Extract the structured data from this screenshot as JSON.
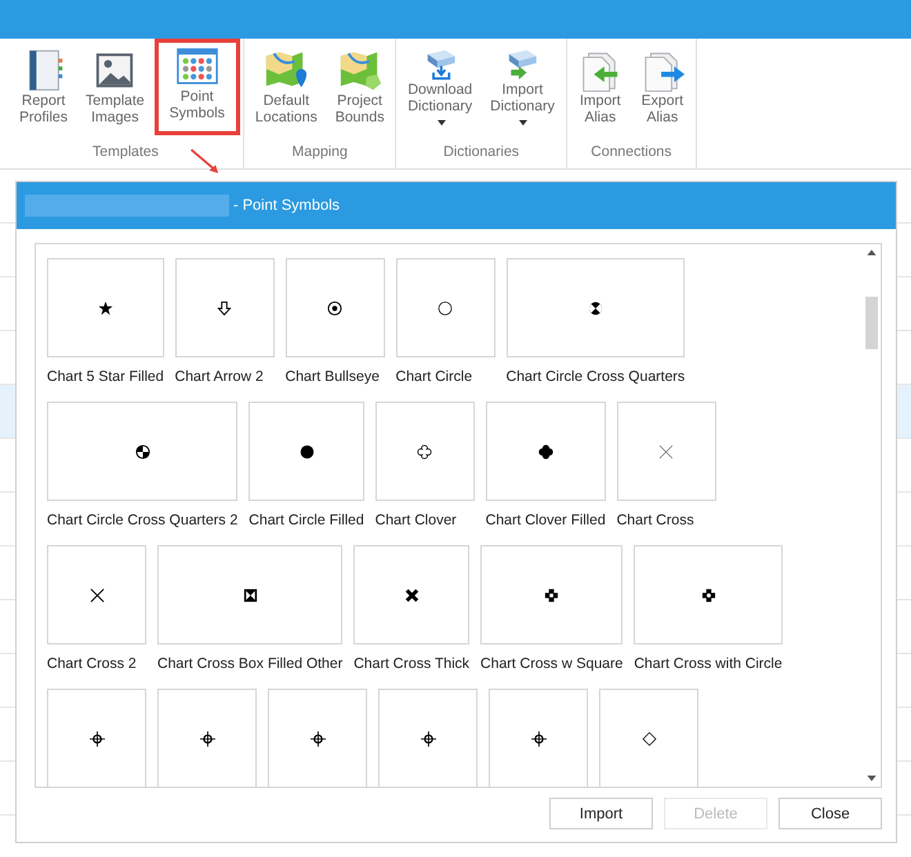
{
  "ribbon": {
    "groups": [
      {
        "label": "Templates",
        "items": [
          {
            "label": "Report Profiles",
            "highlighted": false,
            "dropdown": false
          },
          {
            "label": "Template Images",
            "highlighted": false,
            "dropdown": false
          },
          {
            "label": "Point Symbols",
            "highlighted": true,
            "dropdown": false
          }
        ]
      },
      {
        "label": "Mapping",
        "items": [
          {
            "label": "Default Locations",
            "highlighted": false,
            "dropdown": false
          },
          {
            "label": "Project Bounds",
            "highlighted": false,
            "dropdown": false
          }
        ]
      },
      {
        "label": "Dictionaries",
        "items": [
          {
            "label": "Download Dictionary",
            "highlighted": false,
            "dropdown": true
          },
          {
            "label": "Import Dictionary",
            "highlighted": false,
            "dropdown": true
          }
        ]
      },
      {
        "label": "Connections",
        "items": [
          {
            "label": "Import Alias",
            "highlighted": false,
            "dropdown": false
          },
          {
            "label": "Export Alias",
            "highlighted": false,
            "dropdown": false
          }
        ]
      }
    ]
  },
  "dialog": {
    "title": "- Point Symbols",
    "symbols": [
      {
        "label": "Chart 5 Star Filled",
        "kind": "star"
      },
      {
        "label": "Chart Arrow 2",
        "kind": "arrow"
      },
      {
        "label": "Chart Bullseye",
        "kind": "bullseye"
      },
      {
        "label": "Chart Circle",
        "kind": "circle"
      },
      {
        "label": "Chart Circle Cross Quarters",
        "kind": "quarters"
      },
      {
        "label": "Chart Circle Cross Quarters 2",
        "kind": "quarters2"
      },
      {
        "label": "Chart Circle Filled",
        "kind": "dot"
      },
      {
        "label": "Chart Clover",
        "kind": "clover"
      },
      {
        "label": "Chart Clover Filled",
        "kind": "cloverfilled"
      },
      {
        "label": "Chart Cross",
        "kind": "crossthin"
      },
      {
        "label": "Chart Cross 2",
        "kind": "cross"
      },
      {
        "label": "Chart Cross Box Filled Other",
        "kind": "boxfilled"
      },
      {
        "label": "Chart Cross Thick",
        "kind": "crossthick"
      },
      {
        "label": "Chart Cross w Square",
        "kind": "crosssquare"
      },
      {
        "label": "Chart Cross with Circle",
        "kind": "crosscircle"
      },
      {
        "kind": "crosshair"
      },
      {
        "kind": "crosshair"
      },
      {
        "kind": "crosshair"
      },
      {
        "kind": "crosshair"
      },
      {
        "kind": "crosshair"
      },
      {
        "kind": "diamond"
      }
    ],
    "buttons": [
      {
        "label": "Import",
        "disabled": false
      },
      {
        "label": "Delete",
        "disabled": true
      },
      {
        "label": "Close",
        "disabled": false
      }
    ]
  }
}
